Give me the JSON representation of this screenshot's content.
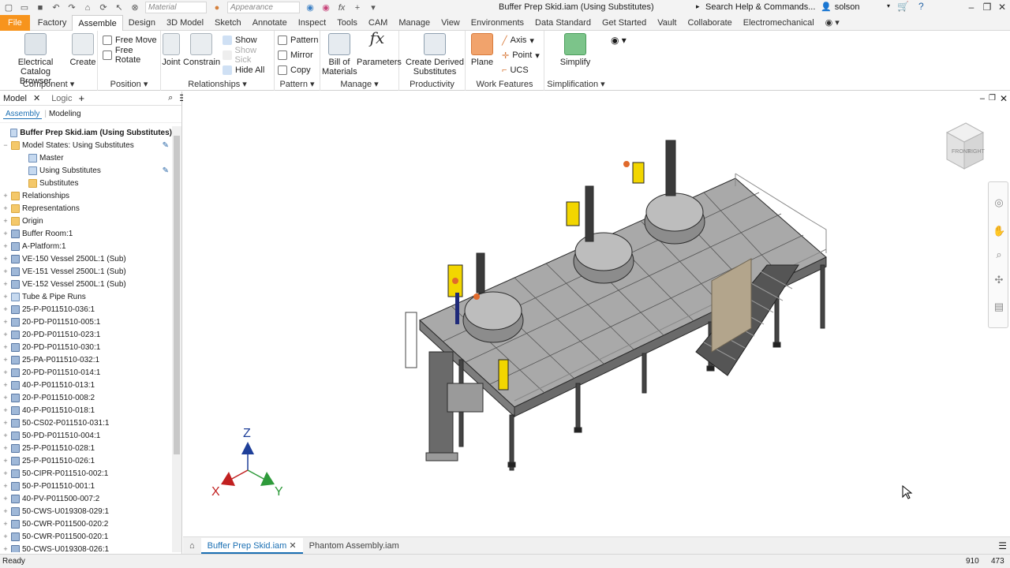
{
  "titlebar": {
    "material_placeholder": "Material",
    "appearance_placeholder": "Appearance",
    "document_title": "Buffer Prep Skid.iam (Using Substitutes)",
    "search_placeholder": "Search Help & Commands...",
    "user": "solson"
  },
  "ribbon_tabs": [
    "File",
    "Factory",
    "Assemble",
    "Design",
    "3D Model",
    "Sketch",
    "Annotate",
    "Inspect",
    "Tools",
    "CAM",
    "Manage",
    "View",
    "Environments",
    "Data Standard",
    "Get Started",
    "Vault",
    "Collaborate",
    "Electromechanical"
  ],
  "active_tab": "Assemble",
  "ribbon": {
    "component": {
      "label": "Component",
      "electrical": "Electrical Catalog Browser",
      "create": "Create"
    },
    "position": {
      "label": "Position",
      "free_move": "Free Move",
      "free_rotate": "Free Rotate"
    },
    "relationships": {
      "label": "Relationships",
      "joint": "Joint",
      "constrain": "Constrain",
      "show": "Show",
      "show_sick": "Show Sick",
      "hide_all": "Hide All"
    },
    "pattern": {
      "label": "Pattern",
      "pattern": "Pattern",
      "mirror": "Mirror",
      "copy": "Copy"
    },
    "manage": {
      "label": "Manage",
      "bom": "Bill of Materials",
      "parameters": "Parameters"
    },
    "productivity": {
      "label": "Productivity",
      "derived": "Create Derived Substitutes"
    },
    "work_features": {
      "label": "Work Features",
      "plane": "Plane",
      "axis": "Axis",
      "point": "Point",
      "ucs": "UCS"
    },
    "simplification": {
      "label": "Simplification",
      "simplify": "Simplify"
    }
  },
  "browser": {
    "tabs": [
      "Model",
      "Logic"
    ],
    "subtabs": [
      "Assembly",
      "Modeling"
    ],
    "tree": [
      {
        "label": "Buffer Prep Skid.iam (Using Substitutes)",
        "level": 0,
        "icon": "assembly",
        "bold": true
      },
      {
        "label": "Model States: Using Substitutes",
        "level": 0,
        "icon": "folder",
        "expanded": true
      },
      {
        "label": "Master",
        "level": 1,
        "icon": "state"
      },
      {
        "label": "Using Substitutes",
        "level": 1,
        "icon": "state-checked"
      },
      {
        "label": "Substitutes",
        "level": 1,
        "icon": "folder"
      },
      {
        "label": "Relationships",
        "level": 0,
        "icon": "folder"
      },
      {
        "label": "Representations",
        "level": 0,
        "icon": "folder"
      },
      {
        "label": "Origin",
        "level": 0,
        "icon": "folder"
      },
      {
        "label": "Buffer Room:1",
        "level": 0,
        "icon": "part"
      },
      {
        "label": "A-Platform:1",
        "level": 0,
        "icon": "part"
      },
      {
        "label": "VE-150 Vessel 2500L:1 (Sub)",
        "level": 0,
        "icon": "part"
      },
      {
        "label": "VE-151 Vessel 2500L:1 (Sub)",
        "level": 0,
        "icon": "part"
      },
      {
        "label": "VE-152 Vessel 2500L:1 (Sub)",
        "level": 0,
        "icon": "part"
      },
      {
        "label": "Tube & Pipe Runs",
        "level": 0,
        "icon": "assembly"
      },
      {
        "label": "25-P-P011510-036:1",
        "level": 0,
        "icon": "part"
      },
      {
        "label": "20-PD-P011510-005:1",
        "level": 0,
        "icon": "part"
      },
      {
        "label": "20-PD-P011510-023:1",
        "level": 0,
        "icon": "part"
      },
      {
        "label": "20-PD-P011510-030:1",
        "level": 0,
        "icon": "part"
      },
      {
        "label": "25-PA-P011510-032:1",
        "level": 0,
        "icon": "part"
      },
      {
        "label": "20-PD-P011510-014:1",
        "level": 0,
        "icon": "part"
      },
      {
        "label": "40-P-P011510-013:1",
        "level": 0,
        "icon": "part"
      },
      {
        "label": "20-P-P011510-008:2",
        "level": 0,
        "icon": "part"
      },
      {
        "label": "40-P-P011510-018:1",
        "level": 0,
        "icon": "part"
      },
      {
        "label": "50-CS02-P011510-031:1",
        "level": 0,
        "icon": "part"
      },
      {
        "label": "50-PD-P011510-004:1",
        "level": 0,
        "icon": "part"
      },
      {
        "label": "25-P-P011510-028:1",
        "level": 0,
        "icon": "part"
      },
      {
        "label": "25-P-P011510-026:1",
        "level": 0,
        "icon": "part"
      },
      {
        "label": "50-CIPR-P011510-002:1",
        "level": 0,
        "icon": "part"
      },
      {
        "label": "50-P-P011510-001:1",
        "level": 0,
        "icon": "part"
      },
      {
        "label": "40-PV-P011500-007:2",
        "level": 0,
        "icon": "part"
      },
      {
        "label": "50-CWS-U019308-029:1",
        "level": 0,
        "icon": "part"
      },
      {
        "label": "50-CWR-P011500-020:2",
        "level": 0,
        "icon": "part"
      },
      {
        "label": "50-CWR-P011500-020:1",
        "level": 0,
        "icon": "part"
      },
      {
        "label": "50-CWS-U019308-026:1",
        "level": 0,
        "icon": "part"
      }
    ]
  },
  "viewcube": {
    "faces": [
      "FRONT",
      "RIGHT"
    ]
  },
  "triad": {
    "x": "X",
    "y": "Y",
    "z": "Z"
  },
  "doc_tabs": [
    "Buffer Prep Skid.iam",
    "Phantom Assembly.iam"
  ],
  "status": {
    "text": "Ready",
    "x": "910",
    "y": "473"
  },
  "colors": {
    "file_tab": "#f7941d",
    "accent": "#1a6fb3"
  }
}
